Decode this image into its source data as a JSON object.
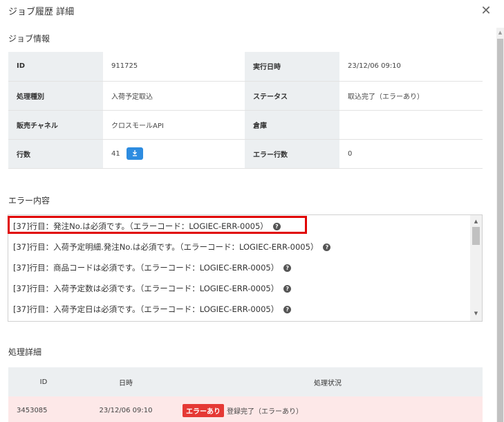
{
  "dialog": {
    "title": "ジョブ履歴 詳細",
    "close_label": "✕"
  },
  "job_info": {
    "section_title": "ジョブ情報",
    "rows": [
      {
        "label1": "ID",
        "value1": "911725",
        "label2": "実行日時",
        "value2": "23/12/06 09:10"
      },
      {
        "label1": "処理種別",
        "value1": "入荷予定取込",
        "label2": "ステータス",
        "value2": "取込完了（エラーあり）"
      },
      {
        "label1": "販売チャネル",
        "value1": "クロスモールAPI",
        "label2": "倉庫",
        "value2": ""
      },
      {
        "label1": "行数",
        "value1": "41",
        "label2": "エラー行数",
        "value2": "0"
      }
    ],
    "download_icon": "download-icon"
  },
  "errors": {
    "section_title": "エラー内容",
    "lines": [
      "[37]行目：発注No.は必須です。（エラーコード：LOGIEC-ERR-0005）",
      "[37]行目：入荷予定明細.発注No.は必須です。（エラーコード：LOGIEC-ERR-0005）",
      "[37]行目：商品コードは必須です。（エラーコード：LOGIEC-ERR-0005）",
      "[37]行目：入荷予定数は必須です。（エラーコード：LOGIEC-ERR-0005）",
      "[37]行目：入荷予定日は必須です。（エラーコード：LOGIEC-ERR-0005）"
    ],
    "help_glyph": "?"
  },
  "details": {
    "section_title": "処理詳細",
    "columns": [
      "ID",
      "日時",
      "処理状況"
    ],
    "rows": [
      {
        "id": "3453085",
        "datetime": "23/12/06 09:10",
        "badge": "エラーあり",
        "status": "登録完了（エラーあり）"
      }
    ]
  },
  "colors": {
    "accent": "#2d8ce0",
    "error": "#e53935",
    "highlight": "#e00000",
    "row_error_bg": "#fde8e8"
  }
}
